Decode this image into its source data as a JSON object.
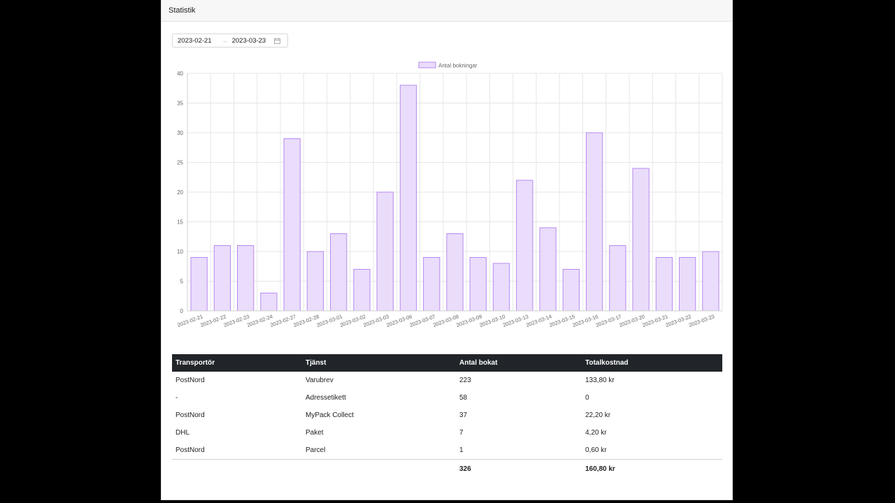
{
  "panel": {
    "title": "Statistik"
  },
  "date_range": {
    "start": "2023-02-21",
    "separator": "→",
    "end": "2023-03-23"
  },
  "chart_data": {
    "type": "bar",
    "categories": [
      "2023-02-21",
      "2023-02-22",
      "2023-02-23",
      "2023-02-24",
      "2023-02-27",
      "2023-02-28",
      "2023-03-01",
      "2023-03-02",
      "2023-03-03",
      "2023-03-06",
      "2023-03-07",
      "2023-03-08",
      "2023-03-09",
      "2023-03-10",
      "2023-03-13",
      "2023-03-14",
      "2023-03-15",
      "2023-03-16",
      "2023-03-17",
      "2023-03-20",
      "2023-03-21",
      "2023-03-22",
      "2023-03-23"
    ],
    "series": [
      {
        "name": "Antal bokningar",
        "values": [
          9,
          11,
          11,
          3,
          29,
          10,
          13,
          7,
          20,
          38,
          9,
          13,
          9,
          8,
          22,
          14,
          7,
          30,
          11,
          24,
          9,
          9,
          10
        ]
      }
    ],
    "ylim": [
      0,
      40
    ],
    "yticks": [
      0,
      5,
      10,
      15,
      20,
      25,
      30,
      35,
      40
    ],
    "legend": "top-center",
    "grid": true,
    "colors": {
      "bar_fill": "#eadcfb",
      "bar_stroke": "#b78af0"
    }
  },
  "table": {
    "headers": [
      "Transportör",
      "Tjänst",
      "Antal bokat",
      "Totalkostnad"
    ],
    "rows": [
      [
        "PostNord",
        "Varubrev",
        "223",
        "133,80 kr"
      ],
      [
        "-",
        "Adressetikett",
        "58",
        "0"
      ],
      [
        "PostNord",
        "MyPack Collect",
        "37",
        "22,20 kr"
      ],
      [
        "DHL",
        "Paket",
        "7",
        "4,20 kr"
      ],
      [
        "PostNord",
        "Parcel",
        "1",
        "0,60 kr"
      ]
    ],
    "footer": [
      "",
      "",
      "326",
      "160,80 kr"
    ]
  }
}
